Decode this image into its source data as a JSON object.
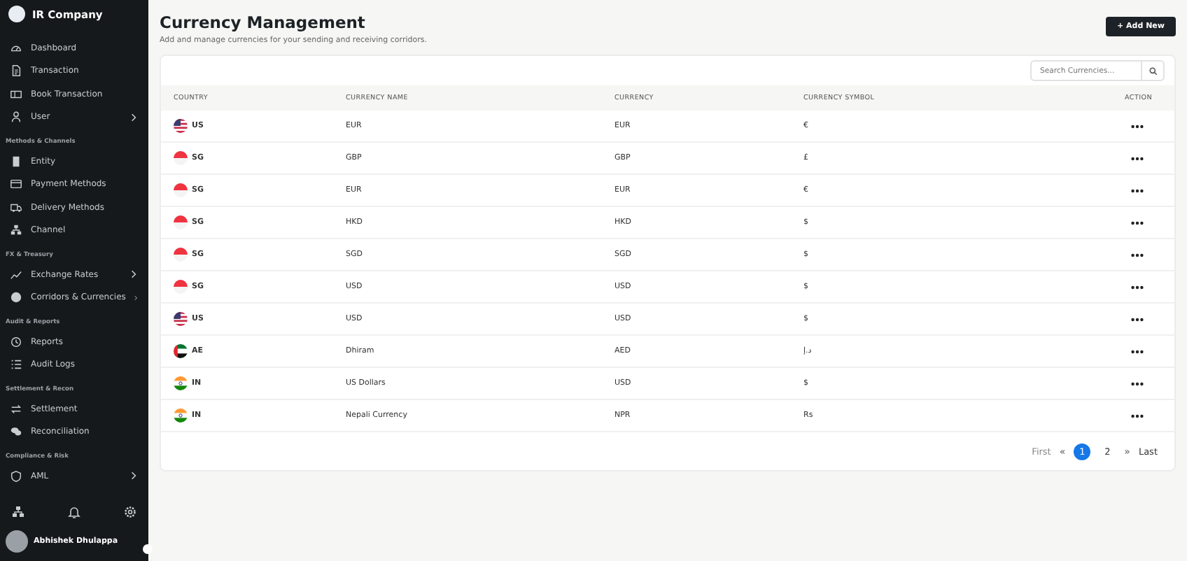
{
  "sidebar": {
    "brand": "IR Company",
    "sections": [
      {
        "items": [
          {
            "label": "Dashboard",
            "expandable": false
          },
          {
            "label": "Transaction",
            "expandable": false
          },
          {
            "label": "Book Transaction",
            "expandable": false
          },
          {
            "label": "User",
            "expandable": true
          }
        ]
      },
      {
        "title": "Methods & Channels",
        "items": [
          {
            "label": "Entity",
            "expandable": false
          },
          {
            "label": "Payment Methods",
            "expandable": false
          },
          {
            "label": "Delivery Methods",
            "expandable": false
          },
          {
            "label": "Channel",
            "expandable": false
          }
        ]
      },
      {
        "title": "FX & Treasury",
        "items": [
          {
            "label": "Exchange Rates",
            "expandable": true
          },
          {
            "label": "Corridors & Currencies",
            "expandable": true
          }
        ]
      },
      {
        "title": "Audit & Reports",
        "items": [
          {
            "label": "Reports",
            "expandable": false
          },
          {
            "label": "Audit Logs",
            "expandable": false
          }
        ]
      },
      {
        "title": "Settlement & Recon",
        "items": [
          {
            "label": "Settlement",
            "expandable": false
          },
          {
            "label": "Reconciliation",
            "expandable": false
          }
        ]
      },
      {
        "title": "Compliance & Risk",
        "items": [
          {
            "label": "AML",
            "expandable": true
          }
        ]
      }
    ],
    "user": {
      "name": "Abhishek Dhulappa"
    }
  },
  "header": {
    "title": "Currency Management",
    "subtitle": "Add and manage currencies for your sending and receiving corridors.",
    "add_button": "+ Add New"
  },
  "search": {
    "placeholder": "Search Currencies..."
  },
  "table": {
    "columns": [
      "COUNTRY",
      "CURRENCY NAME",
      "CURRENCY",
      "CURRENCY SYMBOL",
      "ACTION"
    ],
    "rows": [
      {
        "kind": "us",
        "country": "US",
        "name": "EUR",
        "currency": "EUR",
        "symbol": "€"
      },
      {
        "kind": "sg",
        "country": "SG",
        "name": "GBP",
        "currency": "GBP",
        "symbol": "£"
      },
      {
        "kind": "sg",
        "country": "SG",
        "name": "EUR",
        "currency": "EUR",
        "symbol": "€"
      },
      {
        "kind": "sg",
        "country": "SG",
        "name": "HKD",
        "currency": "HKD",
        "symbol": "$"
      },
      {
        "kind": "sg",
        "country": "SG",
        "name": "SGD",
        "currency": "SGD",
        "symbol": "$"
      },
      {
        "kind": "sg",
        "country": "SG",
        "name": "USD",
        "currency": "USD",
        "symbol": "$"
      },
      {
        "kind": "us",
        "country": "US",
        "name": "USD",
        "currency": "USD",
        "symbol": "$"
      },
      {
        "kind": "ae",
        "country": "AE",
        "name": "Dhiram",
        "currency": "AED",
        "symbol": "د.إ"
      },
      {
        "kind": "in",
        "country": "IN",
        "name": "US Dollars",
        "currency": "USD",
        "symbol": "$"
      },
      {
        "kind": "in",
        "country": "IN",
        "name": "Nepali Currency",
        "currency": "NPR",
        "symbol": "Rs"
      }
    ]
  },
  "pagination": {
    "first": "First",
    "prev": "«",
    "pages": [
      {
        "label": "1",
        "selected": true
      },
      {
        "label": "2",
        "selected": false
      }
    ],
    "next": "»",
    "last": "Last"
  }
}
